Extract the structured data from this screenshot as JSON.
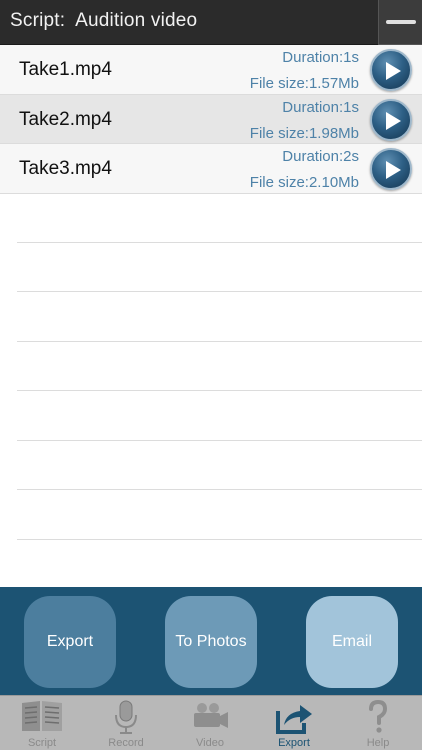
{
  "header": {
    "title": "Script:  Audition video",
    "menu_icon": "minus-icon"
  },
  "takes": [
    {
      "name": "Take1.mp4",
      "duration": "Duration:1s",
      "size": "File size:1.57Mb",
      "selected": false
    },
    {
      "name": "Take2.mp4",
      "duration": "Duration:1s",
      "size": "File size:1.98Mb",
      "selected": true
    },
    {
      "name": "Take3.mp4",
      "duration": "Duration:2s",
      "size": "File size:2.10Mb",
      "selected": false
    }
  ],
  "actions": {
    "export_label": "Export",
    "photos_label": "To Photos",
    "email_label": "Email"
  },
  "tabs": [
    {
      "label": "Script",
      "icon": "script-icon"
    },
    {
      "label": "Record",
      "icon": "microphone-icon"
    },
    {
      "label": "Video",
      "icon": "video-camera-icon"
    },
    {
      "label": "Export",
      "icon": "export-icon",
      "active": true
    },
    {
      "label": "Help",
      "icon": "help-icon"
    }
  ],
  "colors": {
    "header_bg": "#2b2b2b",
    "accent": "#1c5373",
    "info_text": "#4e82a8"
  }
}
